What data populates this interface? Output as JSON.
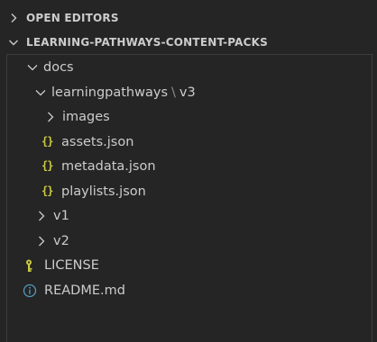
{
  "sections": {
    "open_editors": "OPEN EDITORS",
    "project": "LEARNING-PATHWAYS-CONTENT-PACKS"
  },
  "tree": [
    {
      "label": "docs",
      "kind": "folder-open"
    },
    {
      "label": "learningpathways",
      "sep": "\\",
      "sub": "v3",
      "kind": "folder-open"
    },
    {
      "label": "images",
      "kind": "folder-closed"
    },
    {
      "label": "assets.json",
      "kind": "json"
    },
    {
      "label": "metadata.json",
      "kind": "json"
    },
    {
      "label": "playlists.json",
      "kind": "json"
    },
    {
      "label": "v1",
      "kind": "folder-closed"
    },
    {
      "label": "v2",
      "kind": "folder-closed"
    },
    {
      "label": "LICENSE",
      "kind": "license"
    },
    {
      "label": "README.md",
      "kind": "info"
    }
  ],
  "icons": {
    "json": "{}",
    "json_color": "#cbcb41",
    "license_color": "#cbcb41",
    "info_color": "#519aba"
  }
}
